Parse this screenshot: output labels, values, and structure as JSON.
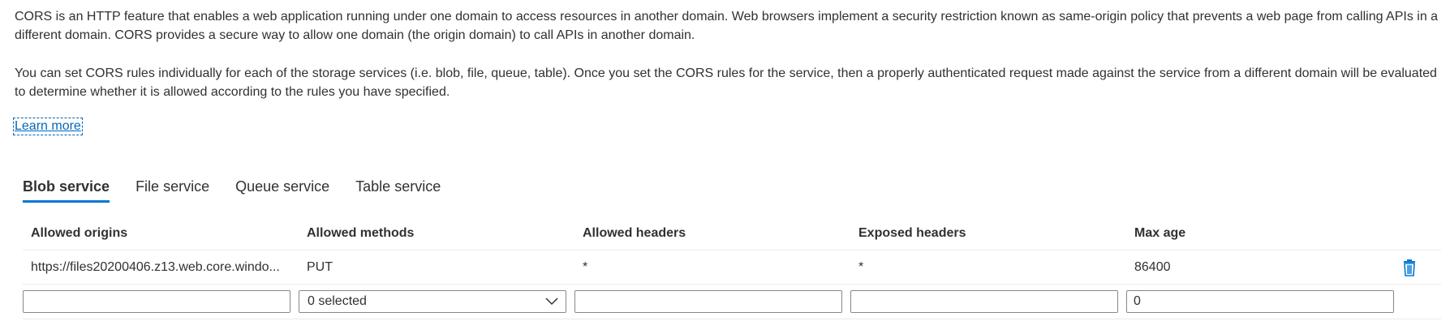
{
  "intro": {
    "paragraph1": "CORS is an HTTP feature that enables a web application running under one domain to access resources in another domain. Web browsers implement a security restriction known as same-origin policy that prevents a web page from calling APIs in a different domain. CORS provides a secure way to allow one domain (the origin domain) to call APIs in another domain.",
    "paragraph2": "You can set CORS rules individually for each of the storage services (i.e. blob, file, queue, table). Once you set the CORS rules for the service, then a properly authenticated request made against the service from a different domain will be evaluated to determine whether it is allowed according to the rules you have specified.",
    "learn_more": "Learn more"
  },
  "tabs": [
    {
      "label": "Blob service",
      "active": true
    },
    {
      "label": "File service",
      "active": false
    },
    {
      "label": "Queue service",
      "active": false
    },
    {
      "label": "Table service",
      "active": false
    }
  ],
  "table": {
    "columns": [
      "Allowed origins",
      "Allowed methods",
      "Allowed headers",
      "Exposed headers",
      "Max age"
    ],
    "rows": [
      [
        "https://files20200406.z13.web.core.windo...",
        "PUT",
        "*",
        "*",
        "86400"
      ]
    ],
    "delete_icon": "trash-icon",
    "new_row": {
      "origins": "",
      "methods": "0 selected",
      "headers": "",
      "exposed": "",
      "max_age": "0"
    }
  },
  "colors": {
    "accent": "#0078d4",
    "link": "#0067b8",
    "text": "#323130",
    "border": "#8a8886"
  }
}
